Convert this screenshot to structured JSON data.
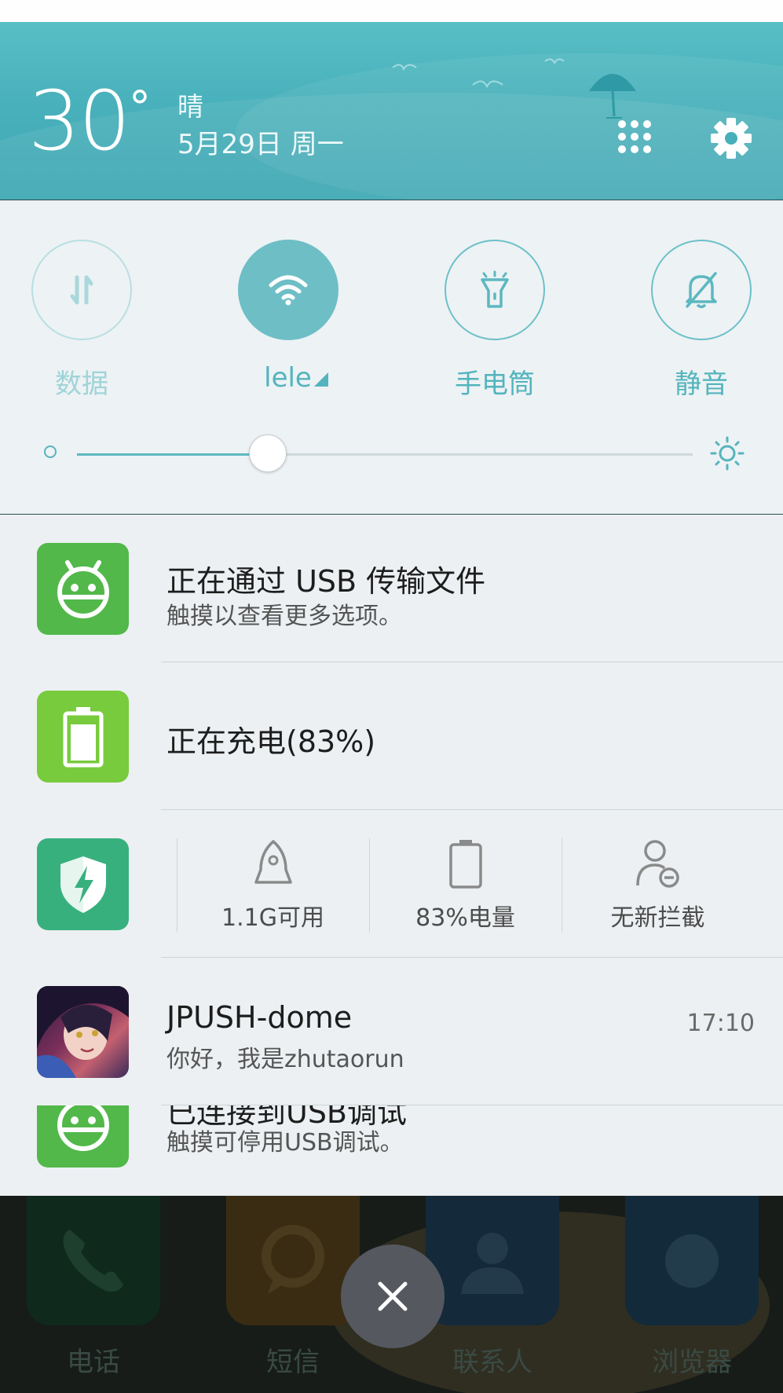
{
  "weather": {
    "temperature": "30",
    "unit": "°",
    "condition": "晴",
    "date": "5月29日 周一"
  },
  "header_icons": {
    "apps": "grid-icon",
    "settings": "gear-icon"
  },
  "toggles": [
    {
      "label": "数据",
      "icon": "data-arrows-icon",
      "state": "off"
    },
    {
      "label": "lele",
      "icon": "wifi-icon",
      "state": "on"
    },
    {
      "label": "手电筒",
      "icon": "flashlight-icon",
      "state": "off"
    },
    {
      "label": "静音",
      "icon": "bell-mute-icon",
      "state": "off"
    }
  ],
  "brightness": {
    "level": 0.31
  },
  "notifications": {
    "usb": {
      "title": "正在通过 USB 传输文件",
      "subtitle": "触摸以查看更多选项。"
    },
    "charging": {
      "title": "正在充电(83%)"
    },
    "security": {
      "memory": "1.1G可用",
      "battery": "83%电量",
      "intercept": "无新拦截"
    },
    "jpush": {
      "title": "JPUSH-dome",
      "subtitle": "你好，我是zhutaorun",
      "time": "17:10"
    },
    "usb_debug": {
      "title": "已连接到USB调试",
      "subtitle": "触摸可停用USB调试。"
    }
  },
  "dock": {
    "phone": "电话",
    "sms": "短信",
    "contacts": "联系人",
    "browser": "浏览器"
  },
  "colors": {
    "accent": "#5db8c0",
    "header": "#49b1bb",
    "usb_green": "#52b84a",
    "battery_green": "#78cb3c",
    "security_green": "#38b07e"
  }
}
